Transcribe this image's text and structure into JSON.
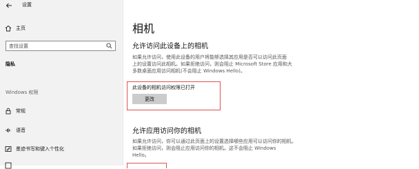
{
  "window": {
    "title": "设置"
  },
  "sidebar": {
    "home_label": "主页",
    "search_placeholder": "查找设置",
    "section_label": "隐私",
    "group_label": "Windows 权限",
    "items": [
      {
        "label": "常规",
        "icon": "lock-icon"
      },
      {
        "label": "语音",
        "icon": "speech-icon"
      },
      {
        "label": "墨迹书写和键入个性化",
        "icon": "ink-icon"
      },
      {
        "label": "",
        "icon": "diagnostics-icon"
      }
    ]
  },
  "main": {
    "page_title": "相机",
    "device_section": {
      "heading": "允许访问此设备上的相机",
      "description": [
        "如果允许访问，使用此设备的用户将能够选择其应用是否可以访问此页面",
        "上的设置访问此相机。如果拒绝访问，则会阻止 Microsoft Store 应用和大",
        "多数桌面应用访问相机(不会阻止 Windows Hello)。"
      ],
      "status": "此设备的相机访问权限已打开",
      "change_button": "更改"
    },
    "app_section": {
      "heading": "允许应用访问你的相机",
      "description": [
        "如果允许访问，你可以通过此页面上的设置选择哪些应用可以访问你的相机。",
        "如果拒绝访问，则会阻止应用访问你的相机。这不会阻止 Windows",
        "Hello。"
      ]
    }
  }
}
